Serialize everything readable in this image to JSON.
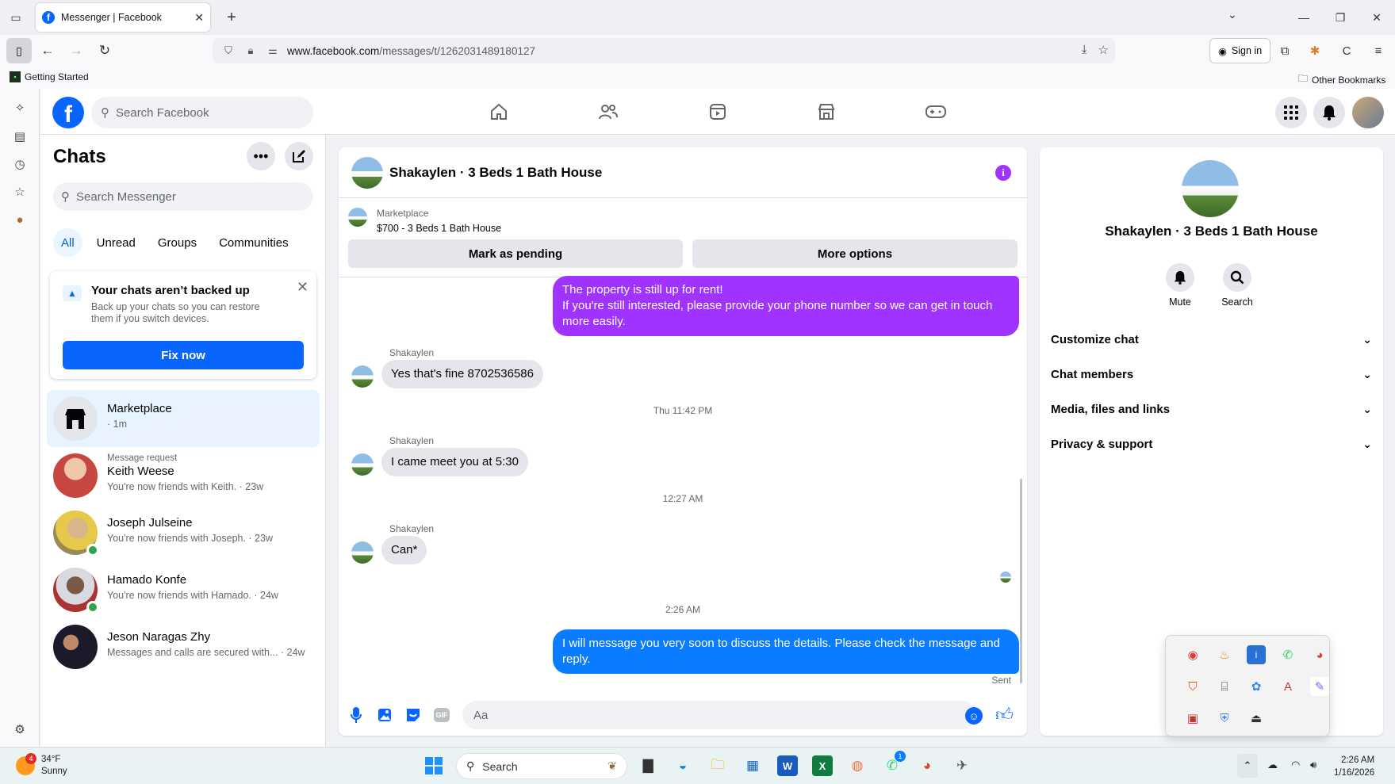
{
  "browser": {
    "tab_title": "Messenger | Facebook",
    "url_domain": "www.facebook.com",
    "url_path": "/messages/t/1262031489180127",
    "signin_label": "Sign in",
    "bookmarks": {
      "getting_started": "Getting Started",
      "other": "Other Bookmarks"
    }
  },
  "header": {
    "search_placeholder": "Search Facebook"
  },
  "chats": {
    "title": "Chats",
    "search_placeholder": "Search Messenger",
    "filters": [
      "All",
      "Unread",
      "Groups",
      "Communities"
    ],
    "backup": {
      "title": "Your chats aren’t backed up",
      "body": "Back up your chats so you can restore them if you switch devices.",
      "button": "Fix now"
    },
    "items": [
      {
        "name": "Marketplace",
        "sub": " · 1m",
        "request": ""
      },
      {
        "name": "Keith Weese",
        "sub": "You're now friends with Keith. · 23w",
        "request": "Message request"
      },
      {
        "name": "Joseph Julseine",
        "sub": "You're now friends with Joseph. · 23w",
        "request": ""
      },
      {
        "name": "Hamado Konfe",
        "sub": "You're now friends with Hamado. · 24w",
        "request": ""
      },
      {
        "name": "Jeson Naragas Zhy",
        "sub": "Messages and calls are secured with... · 24w",
        "request": ""
      }
    ]
  },
  "conversation": {
    "title": "Shakaylen · 3 Beds 1 Bath House",
    "marketplace_label": "Marketplace",
    "listing": "$700 - 3 Beds 1 Bath House",
    "mark_pending": "Mark as pending",
    "more_options": "More options",
    "messages": {
      "m1_line1": "The property is still up for rent!",
      "m1_line2": "If you're still interested, please provide your phone number so we can get in touch more easily.",
      "sender": "Shakaylen",
      "m2": "Yes that's fine 8702536586",
      "ts1": "Thu 11:42 PM",
      "m3": "I came meet you at 5:30",
      "ts2": "12:27 AM",
      "m4": "Can*",
      "ts3": "2:26 AM",
      "m5": "I will message you very soon to discuss the details. Please check the message and reply.",
      "sent": "Sent"
    },
    "composer_placeholder": "Aa",
    "gif_label": "GIF"
  },
  "info_panel": {
    "name": "Shakaylen · 3 Beds 1 Bath House",
    "mute": "Mute",
    "search": "Search",
    "sections": [
      "Customize chat",
      "Chat members",
      "Media, files and links",
      "Privacy & support"
    ]
  },
  "taskbar": {
    "temperature": "34°F",
    "condition": "Sunny",
    "weather_badge": "4",
    "search_label": "Search",
    "whatsapp_badge": "1",
    "time": "2:26 AM",
    "date": "1/16/2026"
  },
  "colors": {
    "fb_blue": "#0866ff",
    "purple_bubble": "#a033ff",
    "blue_bubble": "#0a7cff"
  }
}
